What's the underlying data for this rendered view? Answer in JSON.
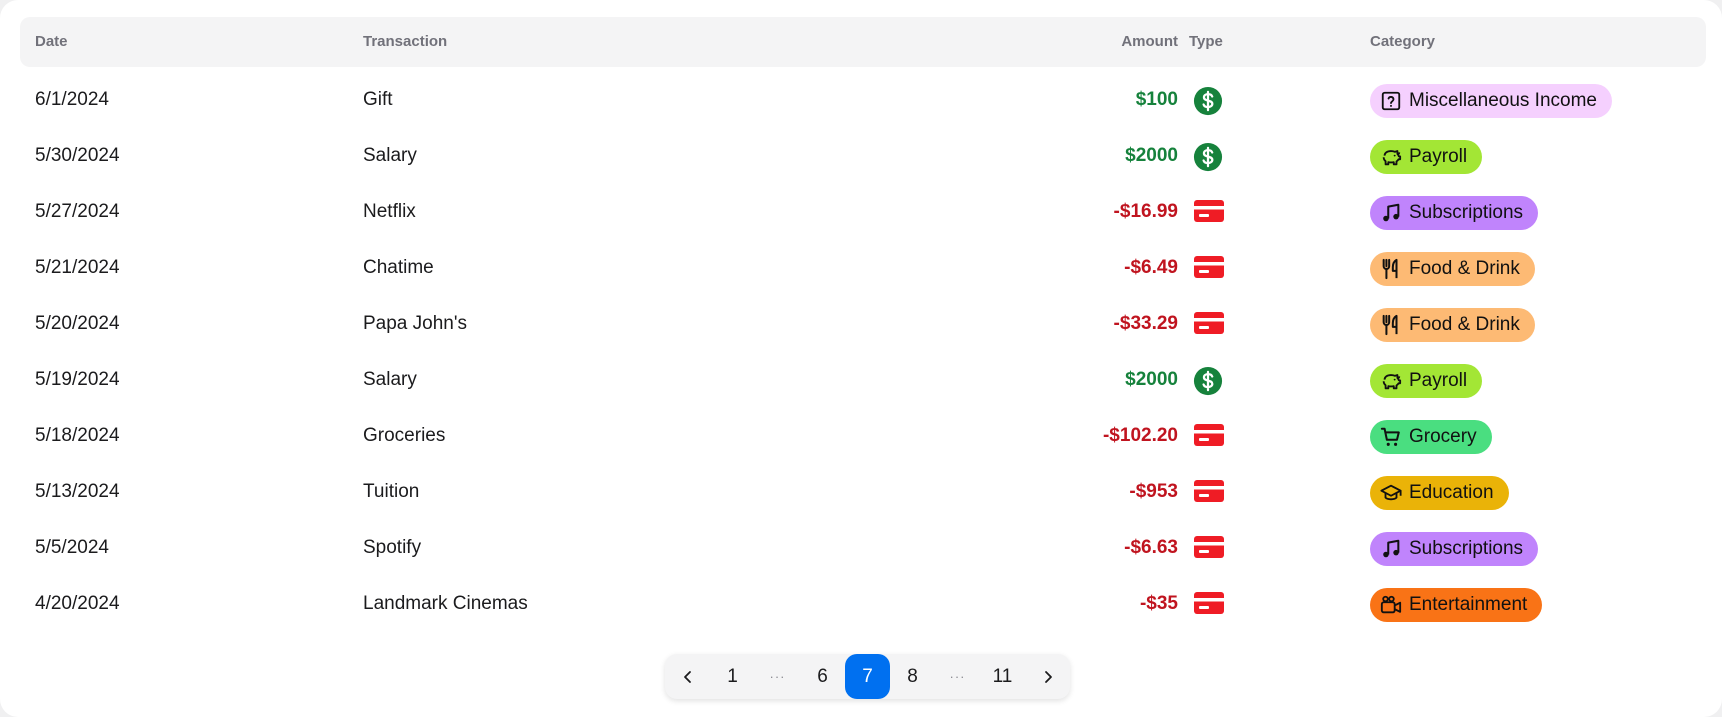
{
  "table": {
    "headers": {
      "date": "Date",
      "transaction": "Transaction",
      "amount": "Amount",
      "type": "Type",
      "category": "Category"
    },
    "rows": [
      {
        "date": "6/1/2024",
        "transaction": "Gift",
        "amount": "$100",
        "type": "income",
        "category": "Miscellaneous Income",
        "category_icon": "question-icon",
        "category_color": "#f5d0fe"
      },
      {
        "date": "5/30/2024",
        "transaction": "Salary",
        "amount": "$2000",
        "type": "income",
        "category": "Payroll",
        "category_icon": "piggy-bank-icon",
        "category_color": "#a3e635"
      },
      {
        "date": "5/27/2024",
        "transaction": "Netflix",
        "amount": "-$16.99",
        "type": "expense",
        "category": "Subscriptions",
        "category_icon": "music-icon",
        "category_color": "#c084fc"
      },
      {
        "date": "5/21/2024",
        "transaction": "Chatime",
        "amount": "-$6.49",
        "type": "expense",
        "category": "Food & Drink",
        "category_icon": "utensils-icon",
        "category_color": "#fdba74"
      },
      {
        "date": "5/20/2024",
        "transaction": "Papa John's",
        "amount": "-$33.29",
        "type": "expense",
        "category": "Food & Drink",
        "category_icon": "utensils-icon",
        "category_color": "#fdba74"
      },
      {
        "date": "5/19/2024",
        "transaction": "Salary",
        "amount": "$2000",
        "type": "income",
        "category": "Payroll",
        "category_icon": "piggy-bank-icon",
        "category_color": "#a3e635"
      },
      {
        "date": "5/18/2024",
        "transaction": "Groceries",
        "amount": "-$102.20",
        "type": "expense",
        "category": "Grocery",
        "category_icon": "shopping-cart-icon",
        "category_color": "#4ade80"
      },
      {
        "date": "5/13/2024",
        "transaction": "Tuition",
        "amount": "-$953",
        "type": "expense",
        "category": "Education",
        "category_icon": "graduation-cap-icon",
        "category_color": "#eab308"
      },
      {
        "date": "5/5/2024",
        "transaction": "Spotify",
        "amount": "-$6.63",
        "type": "expense",
        "category": "Subscriptions",
        "category_icon": "music-icon",
        "category_color": "#c084fc"
      },
      {
        "date": "4/20/2024",
        "transaction": "Landmark Cinemas",
        "amount": "-$35",
        "type": "expense",
        "category": "Entertainment",
        "category_icon": "movie-camera-icon",
        "category_color": "#f97316"
      }
    ]
  },
  "type_icons": {
    "income": "dollar-circle-icon",
    "expense": "credit-card-icon"
  },
  "colors": {
    "income_amount": "#16823c",
    "expense_amount": "#c0141f",
    "income_icon": "#16823c",
    "expense_icon": "#ef1c25",
    "pagination_active": "#0070f0"
  },
  "pagination": {
    "prev_icon": "chevron-left-icon",
    "next_icon": "chevron-right-icon",
    "items": [
      {
        "label": "1",
        "kind": "page"
      },
      {
        "label": "···",
        "kind": "ellipsis"
      },
      {
        "label": "6",
        "kind": "page"
      },
      {
        "label": "7",
        "kind": "page",
        "active": true
      },
      {
        "label": "8",
        "kind": "page"
      },
      {
        "label": "···",
        "kind": "ellipsis"
      },
      {
        "label": "11",
        "kind": "page"
      }
    ]
  }
}
